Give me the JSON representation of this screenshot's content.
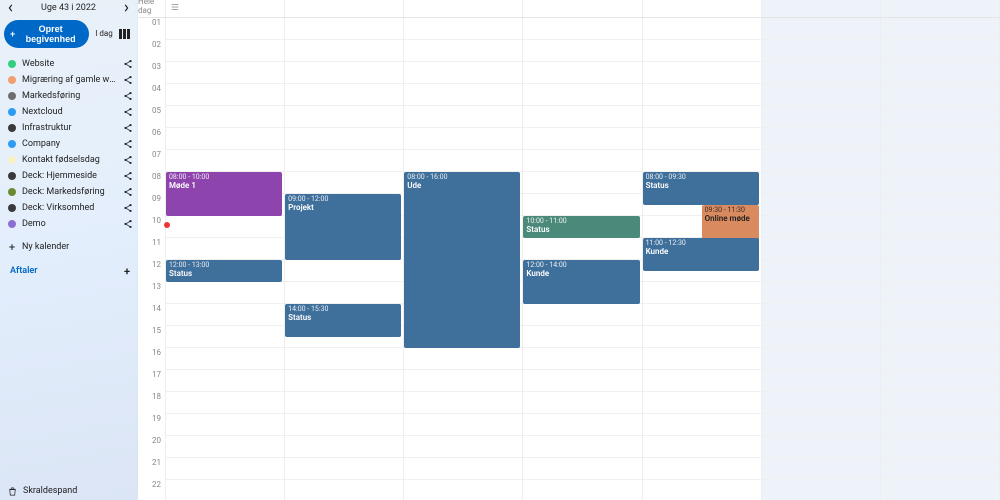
{
  "header": {
    "week_label": "Uge 43 i 2022",
    "create_label": "Opret begivenhed",
    "today_label": "I dag"
  },
  "calendars": [
    {
      "name": "Website",
      "color": "#2fd07f"
    },
    {
      "name": "Migræring af gamle we…",
      "color": "#f29e72"
    },
    {
      "name": "Markedsføring",
      "color": "#6e6e6e"
    },
    {
      "name": "Nextcloud",
      "color": "#2b9cf2"
    },
    {
      "name": "Infrastruktur",
      "color": "#3a3a3a"
    },
    {
      "name": "Company",
      "color": "#2b9cf2"
    },
    {
      "name": "Kontakt fødselsdag",
      "color": "#f7f2c9"
    },
    {
      "name": "Deck: Hjemmeside",
      "color": "#3a3a3a"
    },
    {
      "name": "Deck: Markedsføring",
      "color": "#6a8a2f"
    },
    {
      "name": "Deck: Virksomhed",
      "color": "#3a3a3a"
    },
    {
      "name": "Demo",
      "color": "#8a6fd1"
    }
  ],
  "new_calendar_label": "Ny kalender",
  "section_appointments": "Aftaler",
  "trash_label": "Skraldespand",
  "allday_label": "Hele dag",
  "hours": [
    "01",
    "02",
    "03",
    "04",
    "05",
    "06",
    "07",
    "08",
    "09",
    "10",
    "11",
    "12",
    "13",
    "14",
    "15",
    "16",
    "17",
    "18",
    "19",
    "20",
    "21",
    "22"
  ],
  "hour_height": 22,
  "first_hour": 1,
  "now_day": 0,
  "now_hour": 10.4,
  "events": [
    {
      "day": 0,
      "start": 8,
      "end": 10,
      "time": "08:00 - 10:00",
      "title": "Møde 1",
      "color": "#8e44ad"
    },
    {
      "day": 0,
      "start": 12,
      "end": 13,
      "time": "12:00 - 13:00",
      "title": "Status",
      "color": "#3f6f9b"
    },
    {
      "day": 1,
      "start": 9,
      "end": 12,
      "time": "09:00 - 12:00",
      "title": "Projekt",
      "color": "#3f6f9b"
    },
    {
      "day": 1,
      "start": 14,
      "end": 15.5,
      "time": "14:00 - 15:30",
      "title": "Status",
      "color": "#3f6f9b"
    },
    {
      "day": 2,
      "start": 8,
      "end": 16,
      "time": "08:00 - 16:00",
      "title": "Ude",
      "color": "#3f6f9b"
    },
    {
      "day": 3,
      "start": 10,
      "end": 11,
      "time": "10:00 - 11:00",
      "title": "Status",
      "color": "#4b8a7a"
    },
    {
      "day": 3,
      "start": 12,
      "end": 14,
      "time": "12:00 - 14:00",
      "title": "Kunde",
      "color": "#3f6f9b"
    },
    {
      "day": 4,
      "start": 8,
      "end": 9.5,
      "time": "08:00 - 09:30",
      "title": "Status",
      "color": "#3f6f9b"
    },
    {
      "day": 4,
      "start": 9.5,
      "end": 11.5,
      "time": "09:30 - 11:30",
      "title": "Online møde",
      "color": "#d98a5e",
      "indent": true,
      "text": "#222"
    },
    {
      "day": 4,
      "start": 11,
      "end": 12.5,
      "time": "11:00 - 12:30",
      "title": "Kunde",
      "color": "#3f6f9b"
    }
  ]
}
